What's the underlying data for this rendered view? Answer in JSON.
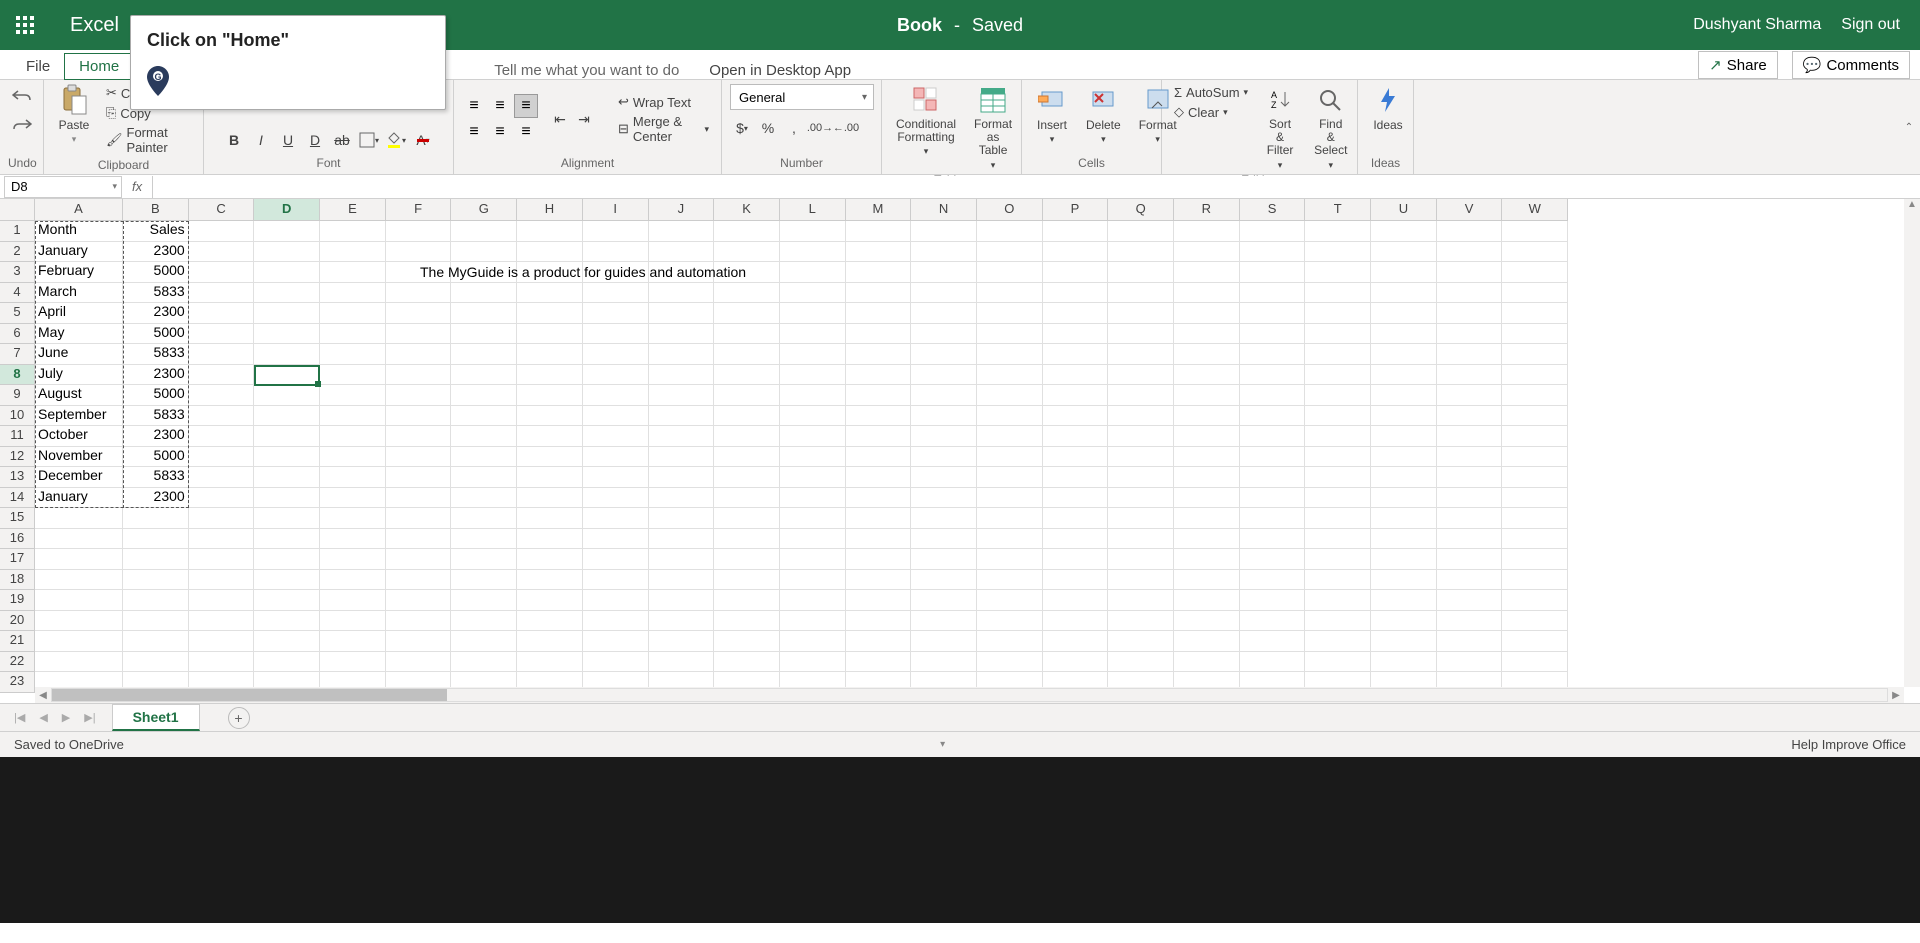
{
  "title": {
    "app": "Excel",
    "doc": "Book",
    "sep": "-",
    "status": "Saved"
  },
  "user": {
    "name": "Dushyant Sharma",
    "signout": "Sign out"
  },
  "menu": {
    "file": "File",
    "home": "Home",
    "tellme": "Tell me what you want to do",
    "desktop": "Open in Desktop App",
    "share": "Share",
    "comments": "Comments"
  },
  "tooltip": {
    "text": "Click on \"Home\""
  },
  "ribbon": {
    "undo": "Undo",
    "paste": "Paste",
    "cut": "Cut",
    "copy": "Copy",
    "fmtpainter": "Format Painter",
    "clipboard": "Clipboard",
    "font": "Font",
    "wrap": "Wrap Text",
    "merge": "Merge & Center",
    "alignment": "Alignment",
    "numfmt": "General",
    "number": "Number",
    "condfmt": "Conditional Formatting",
    "fmttable": "Format as Table",
    "tables": "Tables",
    "insert": "Insert",
    "delete": "Delete",
    "format": "Format",
    "cells": "Cells",
    "autosum": "AutoSum",
    "clear": "Clear",
    "sortfilter": "Sort & Filter",
    "findsel": "Find & Select",
    "editing": "Editing",
    "ideas": "Ideas"
  },
  "namebox": "D8",
  "columns": [
    "A",
    "B",
    "C",
    "D",
    "E",
    "F",
    "G",
    "H",
    "I",
    "J",
    "K",
    "L",
    "M",
    "N",
    "O",
    "P",
    "Q",
    "R",
    "S",
    "T",
    "U",
    "V",
    "W"
  ],
  "selected_col": "D",
  "selected_row": 8,
  "row_count": 23,
  "cells": {
    "A1": "Month",
    "B1": "Sales",
    "A2": "January",
    "B2": "2300",
    "A3": "February",
    "B3": "5000",
    "A4": "March",
    "B4": "5833",
    "A5": "April",
    "B5": "2300",
    "A6": "May",
    "B6": "5000",
    "A7": "June",
    "B7": "5833",
    "A8": "July",
    "B8": "2300",
    "A9": "August",
    "B9": "5000",
    "A10": "September",
    "B10": "5833",
    "A11": "October",
    "B11": "2300",
    "A12": "November",
    "B12": "5000",
    "A13": "December",
    "B13": "5833",
    "A14": "January",
    "B14": "2300"
  },
  "overflow_f3": "The MyGuide is a product for guides and automation",
  "sheet": {
    "name": "Sheet1"
  },
  "status": {
    "left": "Saved to OneDrive",
    "right": "Help Improve Office"
  }
}
